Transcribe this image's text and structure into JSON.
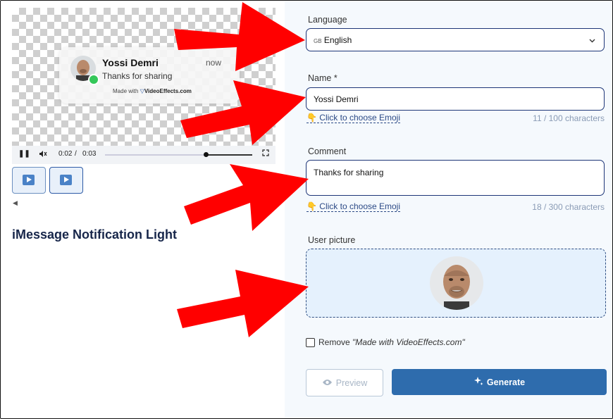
{
  "preview": {
    "sender": "Yossi Demri",
    "time": "now",
    "message": "Thanks for sharing",
    "watermark_prefix": "Made with",
    "watermark_brand": "VideoEffects.com",
    "current_time": "0:02",
    "separator": "/",
    "duration": "0:03",
    "progress_fraction": 0.67
  },
  "page_title": "iMessage Notification Light",
  "form": {
    "language_label": "Language",
    "language_flag": "GB",
    "language_value": "English",
    "name_label": "Name *",
    "name_value": "Yossi Demri",
    "name_emoji_link": "Click to choose Emoji",
    "name_counter": "11 / 100 characters",
    "comment_label": "Comment",
    "comment_value": "Thanks for sharing",
    "comment_emoji_link": "Click to choose Emoji",
    "comment_counter": "18 / 300 characters",
    "picture_label": "User picture",
    "remove_label_prefix": "Remove",
    "remove_label_quote": "\"Made with VideoEffects.com\"",
    "remove_checked": false,
    "preview_button": "Preview",
    "generate_button": "Generate"
  },
  "colors": {
    "accent": "#2e6cad",
    "field_border": "#1d3577",
    "annotation_arrow": "#ff0000"
  }
}
